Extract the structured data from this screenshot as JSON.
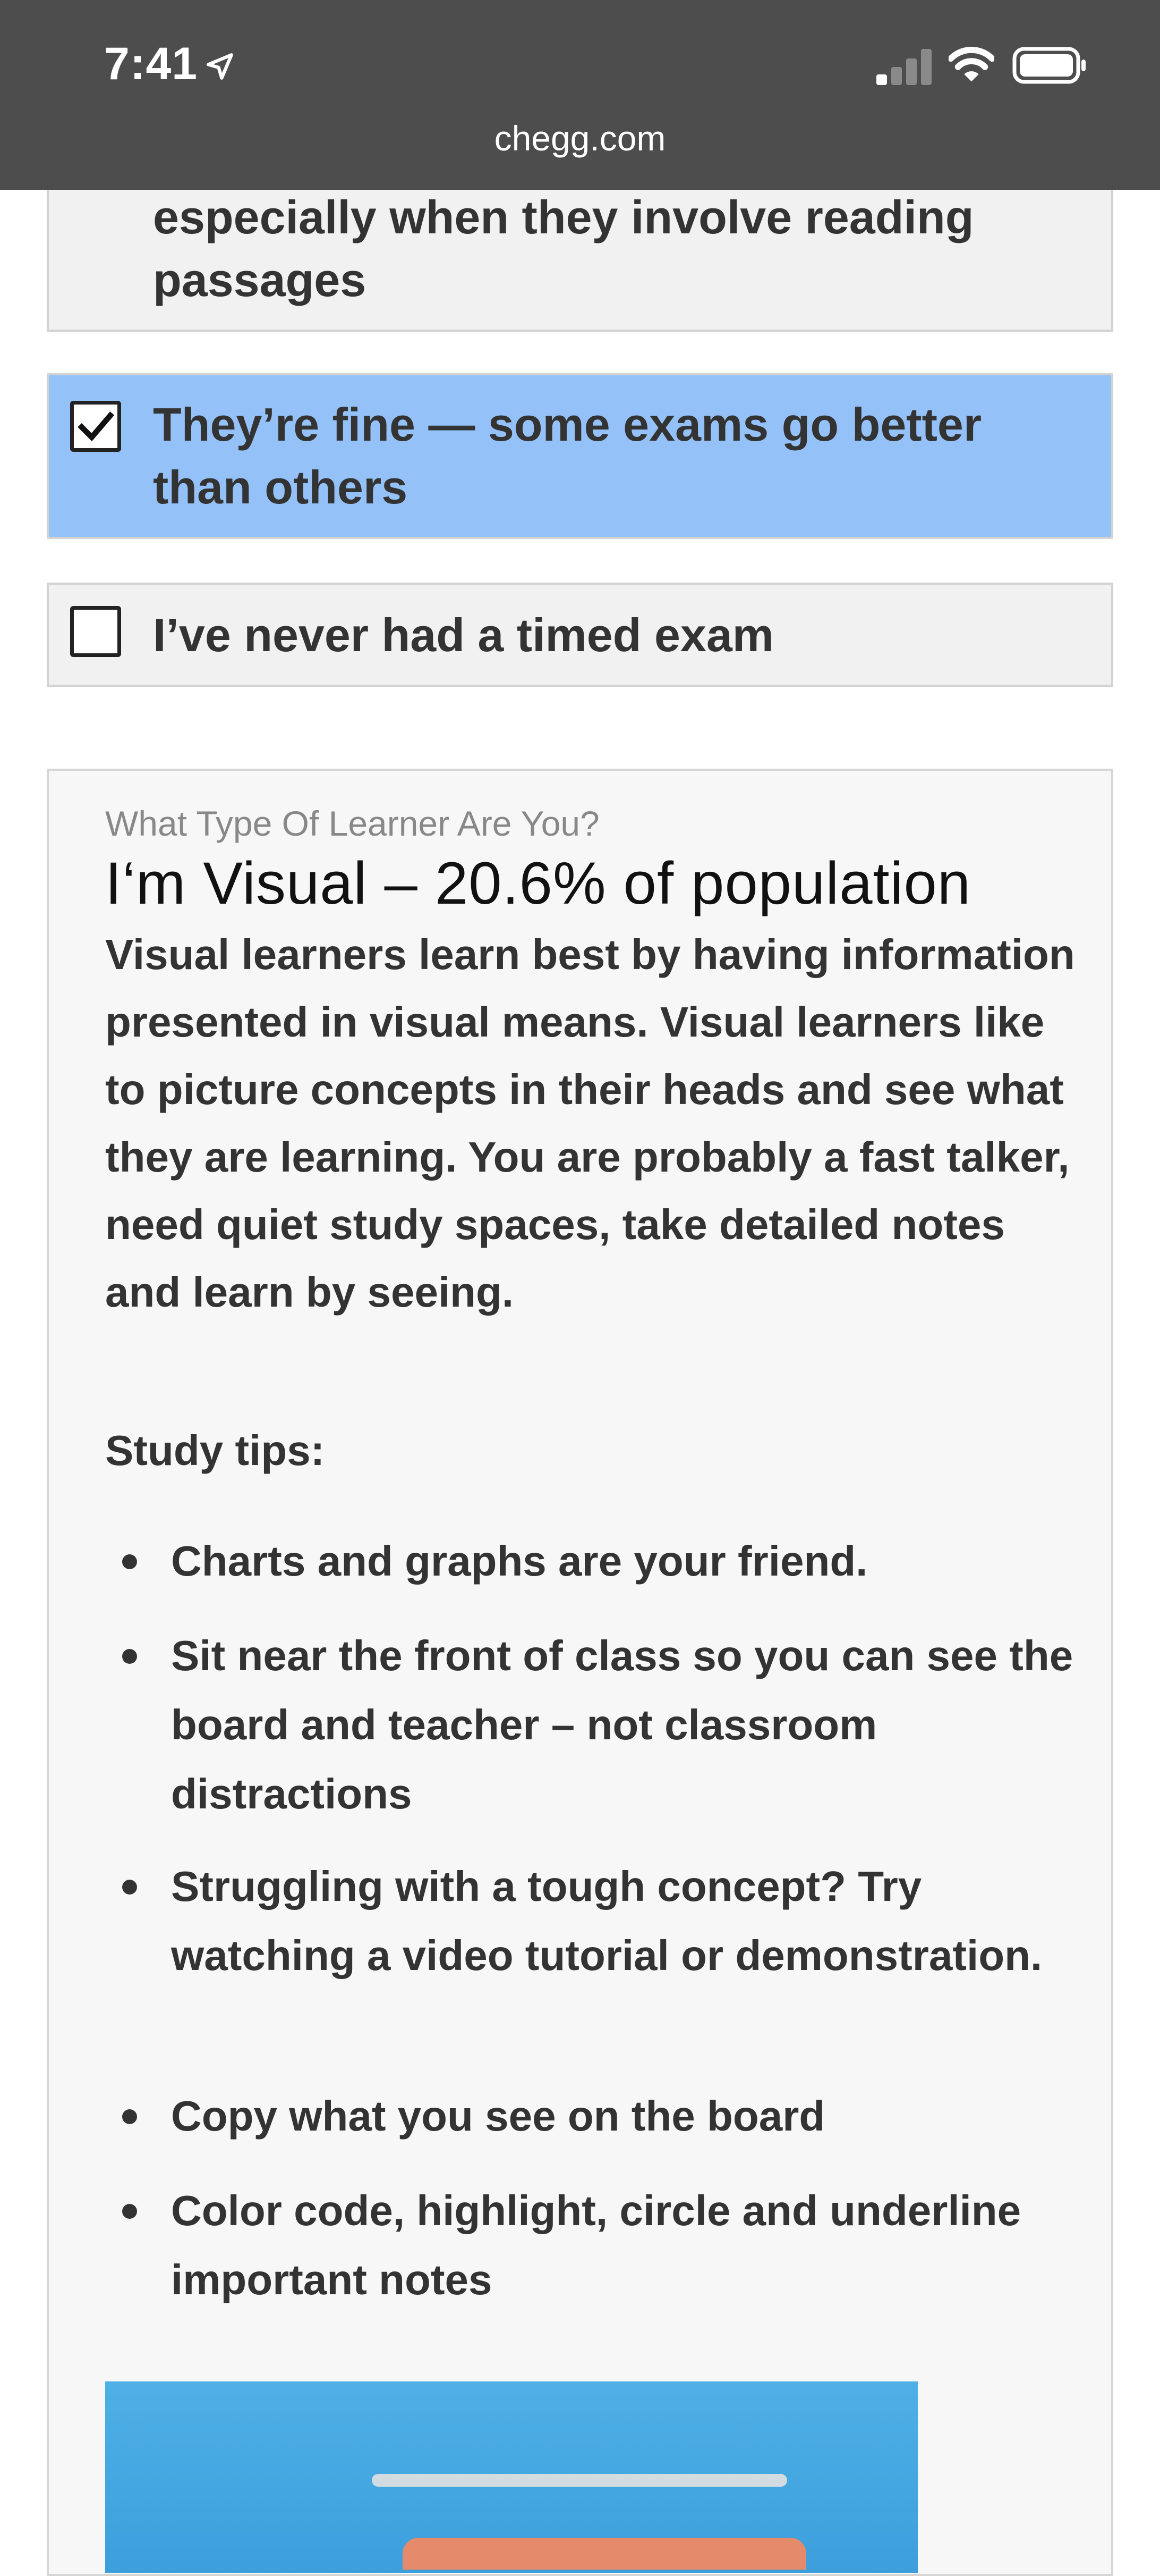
{
  "status_bar": {
    "time": "7:41",
    "icons": [
      "location-arrow-icon",
      "cellular-signal-icon",
      "wifi-icon",
      "battery-icon"
    ]
  },
  "url_bar": {
    "domain": "chegg.com"
  },
  "quiz": {
    "options": [
      {
        "label": "especially when they involve reading passages",
        "checked": false
      },
      {
        "label": "They’re fine — some exams go better than others",
        "checked": true
      },
      {
        "label": "I’ve never had a timed exam",
        "checked": false
      }
    ]
  },
  "result": {
    "eyebrow": "What Type Of Learner Are You?",
    "heading": "I‘m Visual – 20.6% of population",
    "description": "Visual learners learn best by having information presented in visual means. Visual learners like to picture concepts in their heads and see what they are learning. You are probably a fast talker, need quiet study spaces, take detailed notes and learn by seeing.",
    "tips_title": "Study tips:",
    "tips": [
      "Charts and graphs are your friend.",
      "Sit near the front of class so you can see the board and teacher – not classroom distractions",
      "Struggling with a tough concept? Try watching a video tutorial or demonstration.",
      "Copy what you see on the board",
      "Color code, highlight, circle and underline important notes"
    ]
  },
  "colors": {
    "status_bar_bg": "#4d4d4d",
    "selected_option_bg": "#94c1f8",
    "option_bg": "#f1f1f1",
    "card_bg": "#f7f7f7",
    "body_text": "#333333",
    "image_blue": "#4fb0e6"
  }
}
